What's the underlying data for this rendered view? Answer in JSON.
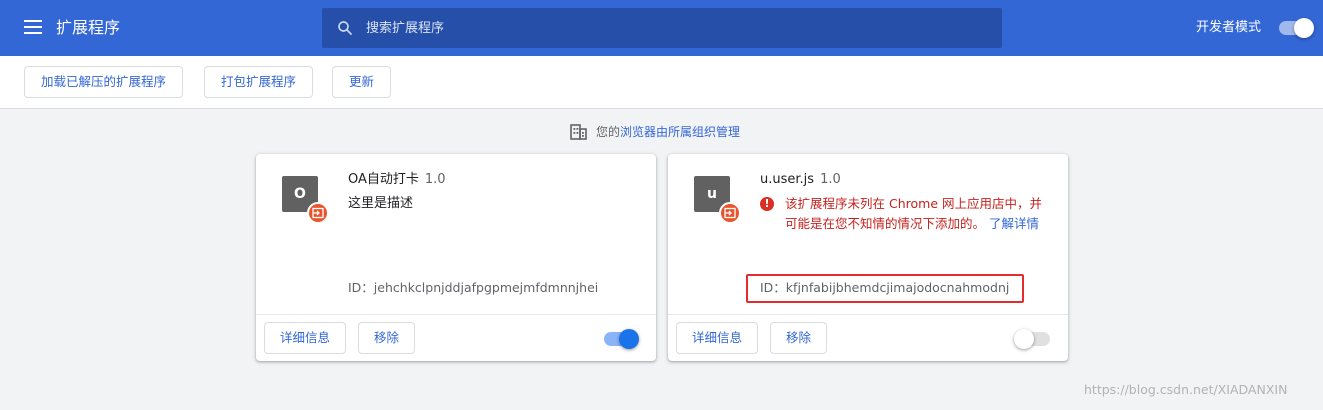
{
  "header": {
    "title": "扩展程序",
    "search_placeholder": "搜索扩展程序",
    "dev_mode_label": "开发者模式"
  },
  "toolbar": {
    "load_unpacked": "加载已解压的扩展程序",
    "pack": "打包扩展程序",
    "update": "更新"
  },
  "managed": {
    "prefix": "您的",
    "link": "浏览器由所属组织管理"
  },
  "extensions": [
    {
      "icon_letter": "O",
      "name": "OA自动打卡",
      "version": "1.0",
      "description": "这里是描述",
      "id_line": "ID：jehchkclpnjddjafpgpmejmfdmnnjhei",
      "details_label": "详细信息",
      "remove_label": "移除"
    },
    {
      "icon_letter": "u",
      "name": "u.user.js",
      "version": "1.0",
      "warning": "该扩展程序未列在 Chrome 网上应用店中，并可能是在您不知情的情况下添加的。",
      "warning_link": "了解详情",
      "id_line": "ID：kfjnfabijbhemdcjimajodocnahmodnj",
      "details_label": "详细信息",
      "remove_label": "移除"
    }
  ],
  "watermark": "https://blog.csdn.net/XIADANXIN",
  "colors": {
    "header_bg": "#3367d6",
    "accent": "#3367d6",
    "warning": "#c5221f",
    "highlight_box": "#e32d2d"
  }
}
